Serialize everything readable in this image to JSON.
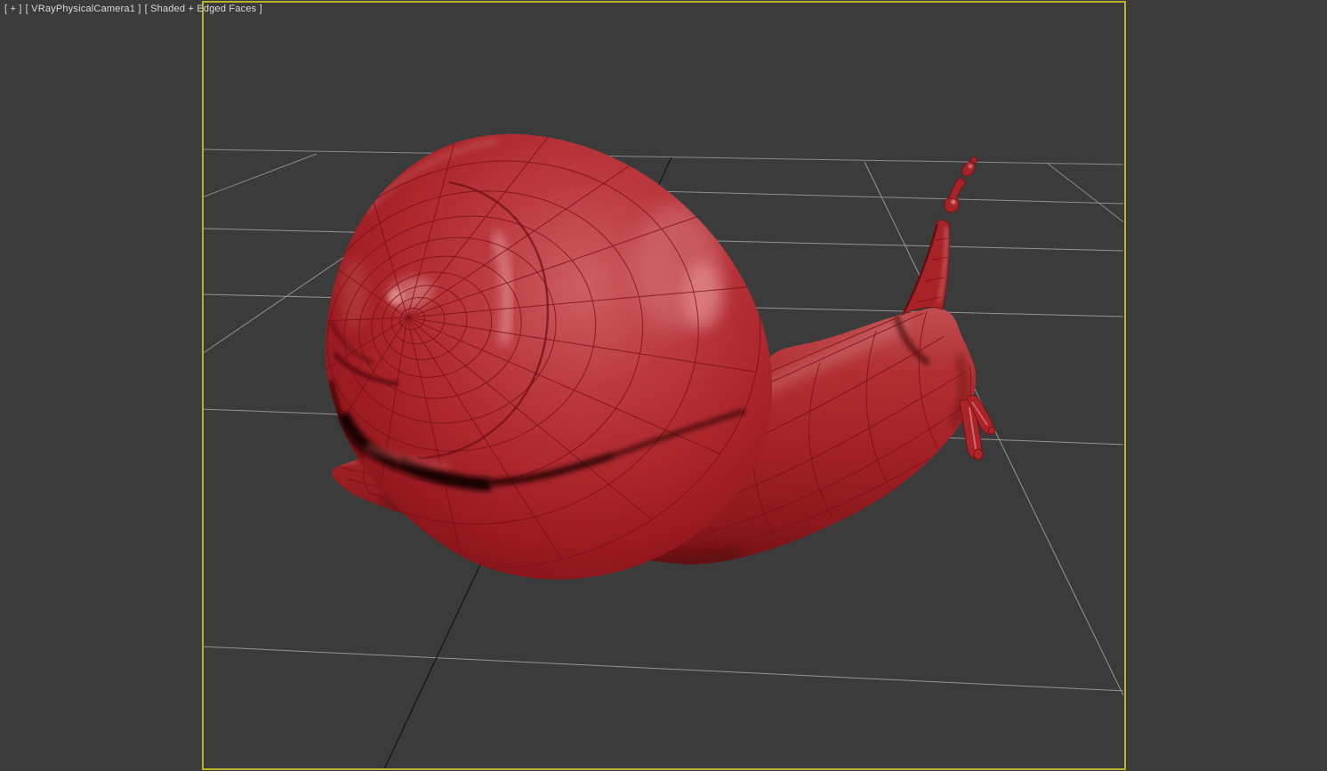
{
  "viewport": {
    "label": {
      "general_menu": "[ + ]",
      "pov_menu": "[ VRayPhysicalCamera1 ]",
      "shading_menu": "[ Shaded + Edged Faces ]"
    },
    "camera_name": "VRayPhysicalCamera1",
    "shading_mode": "Shaded + Edged Faces",
    "colors": {
      "background": "#3b3b3b",
      "active_border": "#b8b22a",
      "grid_line": "#9b9b9b",
      "grid_axis": "#161616",
      "label_text": "#d8d8d8",
      "model_base": "#ad272d",
      "model_edge": "#781015"
    },
    "model": {
      "name": "snail"
    }
  }
}
